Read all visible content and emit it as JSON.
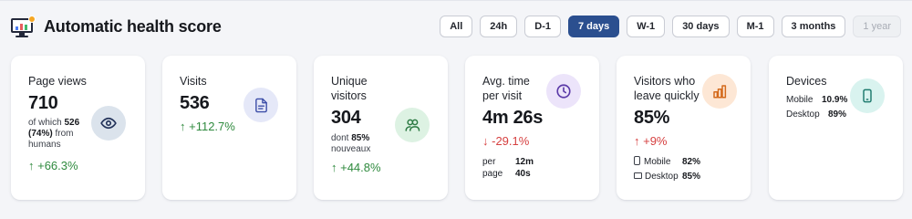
{
  "header": {
    "title": "Automatic health score"
  },
  "ranges": [
    "All",
    "24h",
    "D-1",
    "7 days",
    "W-1",
    "30 days",
    "M-1",
    "3 months",
    "1 year"
  ],
  "ranges_selected": "7 days",
  "ranges_disabled": "1 year",
  "colors": {
    "accent": "#2b4f8f",
    "up": "#2f8a3e",
    "down": "#d64040"
  },
  "cards": {
    "page_views": {
      "title": "Page views",
      "value": "710",
      "sub_pre": "of which",
      "sub_count": "526",
      "sub_pct": "(74%)",
      "sub_post": "from humans",
      "delta": "↑ +66.3%",
      "icon": "eye-icon"
    },
    "visits": {
      "title": "Visits",
      "value": "536",
      "delta": "↑ +112.7%",
      "icon": "document-icon"
    },
    "unique_visitors": {
      "title_line1": "Unique",
      "title_line2": "visitors",
      "value": "304",
      "sub_pre": "dont",
      "sub_pct": "85%",
      "sub_post": "nouveaux",
      "delta": "↑ +44.8%",
      "icon": "users-icon"
    },
    "avg_time": {
      "title_line1": "Avg. time",
      "title_line2": "per visit",
      "value": "4m 26s",
      "delta": "↓ -29.1%",
      "per_label1": "per",
      "per_label2": "page",
      "per_val1": "12m",
      "per_val2": "40s",
      "icon": "clock-icon"
    },
    "leave_quickly": {
      "title_line1": "Visitors who",
      "title_line2": "leave quickly",
      "value": "85%",
      "delta": "↑ +9%",
      "mobile_label": "Mobile",
      "mobile_val": "82%",
      "desktop_label": "Desktop",
      "desktop_val": "85%",
      "icon": "bar-chart-icon"
    },
    "devices": {
      "title": "Devices",
      "mobile_label": "Mobile",
      "mobile_val": "10.9%",
      "desktop_label": "Desktop",
      "desktop_val": "89%",
      "icon": "smartphone-icon"
    }
  }
}
